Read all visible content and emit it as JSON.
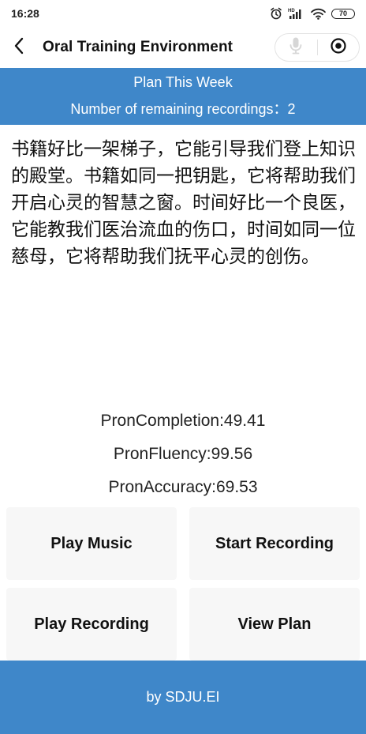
{
  "status_bar": {
    "time": "16:28",
    "signal_label": "HD",
    "battery": "70",
    "icons": [
      "alarm-icon",
      "cellular-signal-icon",
      "wifi-icon",
      "battery-icon"
    ]
  },
  "nav": {
    "title": "Oral Training Environment",
    "back_icon": "chevron-left-icon",
    "mic_icon": "microphone-icon",
    "record_icon": "target-icon"
  },
  "plan": {
    "title": "Plan This Week",
    "remaining": "Number of remaining recordings：2"
  },
  "passage": {
    "text": "书籍好比一架梯子，它能引导我们登上知识的殿堂。书籍如同一把钥匙，它将帮助我们开启心灵的智慧之窗。时间好比一个良医，它能教我们医治流血的伤口，时间如同一位慈母，它将帮助我们抚平心灵的创伤。"
  },
  "scores": {
    "completion": "PronCompletion:49.41",
    "fluency": "PronFluency:99.56",
    "accuracy": "PronAccuracy:69.53"
  },
  "actions": {
    "play_music": "Play Music",
    "start_recording": "Start Recording",
    "play_recording": "Play Recording",
    "view_plan": "View Plan"
  },
  "footer": {
    "text": "by SDJU.EI"
  },
  "colors": {
    "accent": "#3f87c9",
    "button_bg": "#f7f7f7",
    "text": "#111111"
  }
}
